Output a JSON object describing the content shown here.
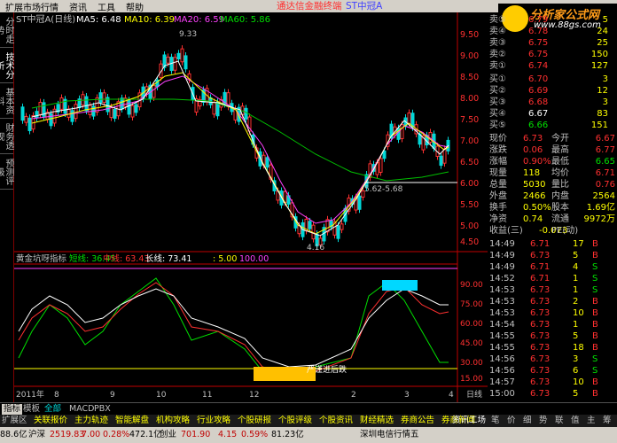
{
  "menu": [
    "扩展市场行情",
    "资讯",
    "工具",
    "帮助"
  ],
  "hint": "通达信金融终端",
  "hint2": "ST中冠A",
  "logo": {
    "main": "分析家公式网",
    "url": "www.88gs.com"
  },
  "side_tabs": [
    "分时走势",
    "技术分析",
    "基本资料",
    "财务透视",
    "预测评级"
  ],
  "chart": {
    "title": "ST中冠A(日线)",
    "ma5": "MA5: 6.48",
    "ma10": "MA10: 6.39",
    "ma20": "MA20: 6.59",
    "ma60": "MA60: 5.86",
    "peak_label": "9.33",
    "low_label": "4.16",
    "range_label": "5.62-5.68",
    "yaxis": [
      "9.50",
      "9.00",
      "8.50",
      "8.00",
      "7.50",
      "7.00",
      "6.50",
      "6.00",
      "5.50",
      "5.00",
      "4.50"
    ],
    "ind_title": "黄金坑呀指标",
    "ind_short": "短线: 36.45",
    "ind_mid": "中线: 63.43",
    "ind_long": "长线: 73.41",
    "ind_5": ": 5.00",
    "ind_100": "100.00",
    "ind_yaxis": [
      "90.00",
      "75.00",
      "60.00",
      "45.00",
      "30.00",
      "15.00"
    ],
    "ind_text": "严谨进后跌",
    "date_labels": [
      "2011年",
      "8",
      "9",
      "10",
      "11",
      "12",
      "2",
      "3",
      "4"
    ],
    "period": "日线"
  },
  "tabs": [
    "指标",
    "模板",
    "全部",
    "MACD",
    "PBX"
  ],
  "quotes": {
    "sell": [
      {
        "l": "卖⑤",
        "p": "6.79",
        "v": "5"
      },
      {
        "l": "卖④",
        "p": "6.78",
        "v": "24"
      },
      {
        "l": "卖③",
        "p": "6.75",
        "v": "25"
      },
      {
        "l": "卖②",
        "p": "6.75",
        "v": "150"
      },
      {
        "l": "卖①",
        "p": "6.74",
        "v": "127"
      }
    ],
    "buy": [
      {
        "l": "买①",
        "p": "6.70",
        "v": "3"
      },
      {
        "l": "买②",
        "p": "6.69",
        "v": "12"
      },
      {
        "l": "买③",
        "p": "6.68",
        "v": "3"
      },
      {
        "l": "买④",
        "p": "6.67",
        "v": "83"
      },
      {
        "l": "买⑤",
        "p": "6.66",
        "v": "151"
      }
    ],
    "stats": [
      {
        "a": "现价",
        "av": "6.73",
        "b": "今开",
        "bv": "6.67"
      },
      {
        "a": "涨跌",
        "av": "0.06",
        "b": "最高",
        "bv": "6.77"
      },
      {
        "a": "涨幅",
        "av": "0.90%",
        "b": "最低",
        "bv": "6.65"
      },
      {
        "a": "现量",
        "av": "118",
        "b": "均价",
        "bv": "6.71"
      },
      {
        "a": "总量",
        "av": "5030",
        "b": "量比",
        "bv": "0.76"
      },
      {
        "a": "外盘",
        "av": "2466",
        "b": "内盘",
        "bv": "2564"
      },
      {
        "a": "换手",
        "av": "0.50%",
        "b": "股本",
        "bv": "1.69亿"
      },
      {
        "a": "净资",
        "av": "0.74",
        "b": "流通",
        "bv": "9972万"
      },
      {
        "a": "收益(三)",
        "av": "-0.073",
        "b": "PE(动)",
        "bv": ""
      }
    ],
    "ticks": [
      {
        "t": "14:49",
        "p": "6.71",
        "v": "17",
        "s": "B"
      },
      {
        "t": "14:49",
        "p": "6.73",
        "v": "5",
        "s": "B"
      },
      {
        "t": "14:49",
        "p": "6.71",
        "v": "4",
        "s": "S"
      },
      {
        "t": "14:52",
        "p": "6.71",
        "v": "1",
        "s": "S"
      },
      {
        "t": "14:53",
        "p": "6.73",
        "v": "1",
        "s": "S"
      },
      {
        "t": "14:53",
        "p": "6.73",
        "v": "2",
        "s": "B"
      },
      {
        "t": "14:53",
        "p": "6.73",
        "v": "10",
        "s": "B"
      },
      {
        "t": "14:54",
        "p": "6.73",
        "v": "1",
        "s": "B"
      },
      {
        "t": "14:55",
        "p": "6.73",
        "v": "5",
        "s": "B"
      },
      {
        "t": "14:55",
        "p": "6.73",
        "v": "18",
        "s": "B"
      },
      {
        "t": "14:56",
        "p": "6.73",
        "v": "3",
        "s": "S"
      },
      {
        "t": "14:56",
        "p": "6.73",
        "v": "6",
        "s": "S"
      },
      {
        "t": "14:57",
        "p": "6.73",
        "v": "10",
        "s": "B"
      },
      {
        "t": "15:00",
        "p": "6.73",
        "v": "5",
        "s": "B"
      }
    ]
  },
  "bottom_tabs": [
    "扩展区",
    "关联报价",
    "主力轨迹",
    "智能解盘",
    "机构攻略",
    "行业攻略",
    "个股研报",
    "个股评级",
    "个股资讯",
    "财经精选",
    "券商公告",
    "券商新闻"
  ],
  "right_tabs": [
    "资讯工场",
    "笔",
    "价",
    "细",
    "势",
    "联",
    "值",
    "主",
    "筹"
  ],
  "status": {
    "sh": "88.6亿",
    "sz": "沪深",
    "sz_val": "2519.83",
    "sz_chg": "7.00",
    "sz_pct": "0.28%",
    "amt": "472.1亿",
    "cy": "创业",
    "cy_val": "701.90",
    "cy_chg": "4.15",
    "cy_pct": "0.59%",
    "cy_amt": "81.23亿",
    "broker": "深圳电信行情五"
  }
}
